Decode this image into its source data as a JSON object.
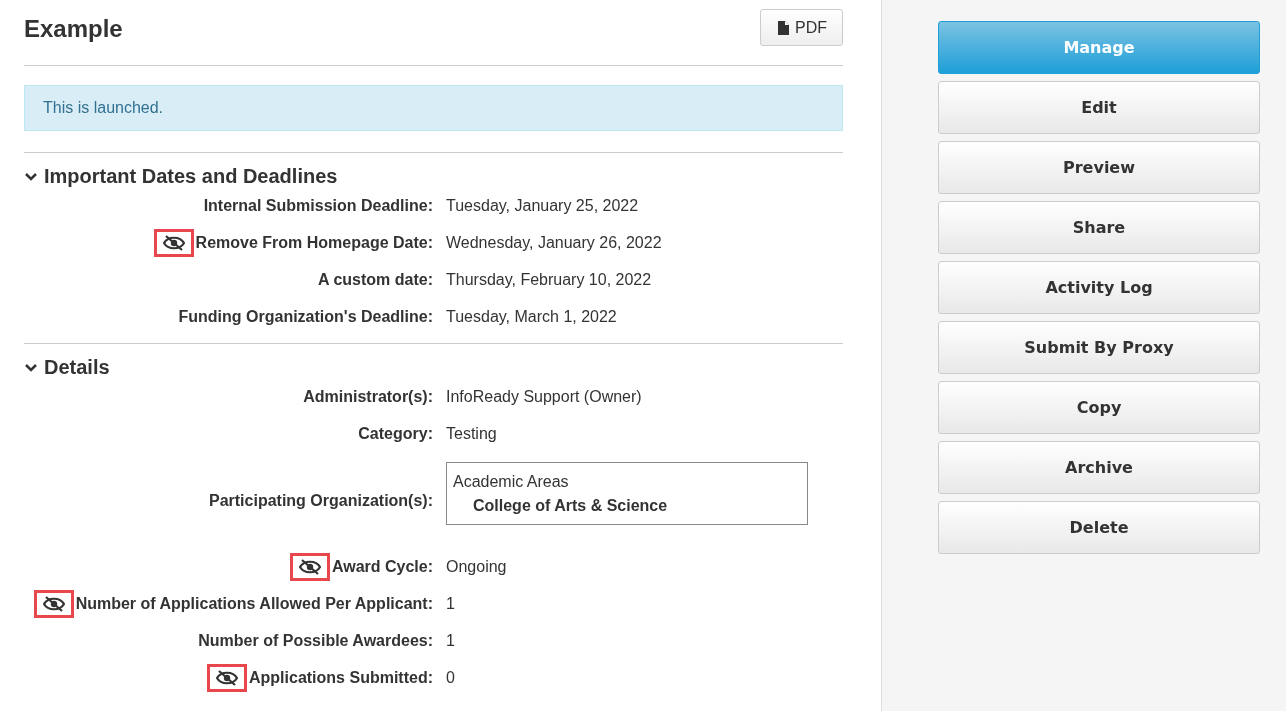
{
  "title": "Example",
  "pdf_button": {
    "label": "PDF"
  },
  "alert": {
    "text": "This is launched."
  },
  "sections": [
    {
      "title": "Important Dates and Deadlines",
      "expanded": true,
      "rows": [
        {
          "kind": "text",
          "label": "Internal Submission Deadline:",
          "hidden": false,
          "value": "Tuesday, January 25, 2022"
        },
        {
          "kind": "text",
          "label": "Remove From Homepage Date:",
          "hidden": true,
          "value": "Wednesday, January 26, 2022"
        },
        {
          "kind": "text",
          "label": "A custom date:",
          "hidden": false,
          "value": "Thursday, February 10, 2022"
        },
        {
          "kind": "text",
          "label": "Funding Organization's Deadline:",
          "hidden": false,
          "value": "Tuesday, March 1, 2022"
        }
      ]
    },
    {
      "title": "Details",
      "expanded": true,
      "rows": [
        {
          "kind": "text",
          "label": "Administrator(s):",
          "hidden": false,
          "value": "InfoReady Support (Owner)"
        },
        {
          "kind": "text",
          "label": "Category:",
          "hidden": false,
          "value": "Testing"
        },
        {
          "kind": "tree",
          "label": "Participating Organization(s):",
          "hidden": false,
          "group": "Academic Areas",
          "children": [
            "College of Arts & Science"
          ]
        },
        {
          "kind": "text",
          "label": "Award Cycle:",
          "hidden": true,
          "value": "Ongoing"
        },
        {
          "kind": "text",
          "label": "Number of Applications Allowed Per Applicant:",
          "hidden": true,
          "value": "1"
        },
        {
          "kind": "text",
          "label": "Number of Possible Awardees:",
          "hidden": false,
          "value": "1"
        },
        {
          "kind": "text",
          "label": "Applications Submitted:",
          "hidden": true,
          "value": "0"
        }
      ]
    }
  ],
  "actions": [
    {
      "label": "Manage",
      "primary": true
    },
    {
      "label": "Edit",
      "primary": false
    },
    {
      "label": "Preview",
      "primary": false
    },
    {
      "label": "Share",
      "primary": false
    },
    {
      "label": "Activity Log",
      "primary": false
    },
    {
      "label": "Submit By Proxy",
      "primary": false
    },
    {
      "label": "Copy",
      "primary": false
    },
    {
      "label": "Archive",
      "primary": false
    },
    {
      "label": "Delete",
      "primary": false
    }
  ]
}
